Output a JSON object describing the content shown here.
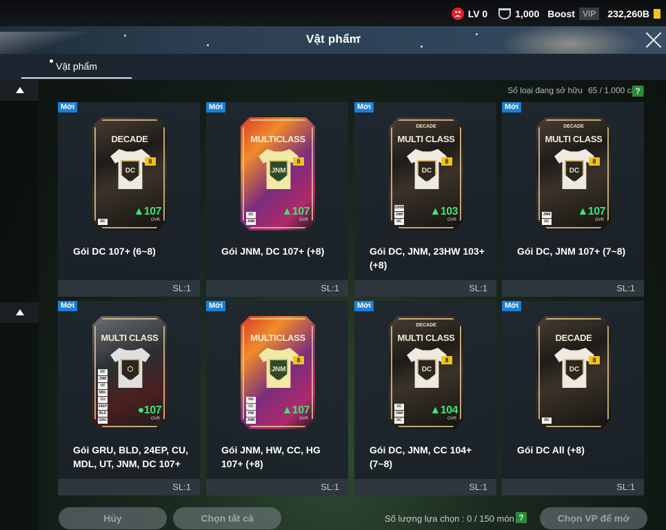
{
  "status": {
    "level": "LV 0",
    "trophies": "1,000",
    "boost": "Boost",
    "vip": "VIP",
    "currency": "232,260B"
  },
  "window": {
    "title": "Vật phẩm"
  },
  "tabs": [
    {
      "label": "Vật phẩm",
      "active": true
    }
  ],
  "inventory": {
    "owned_label": "Số loại đang sở hữu",
    "owned_value": "65 / 1.000 cái",
    "help": "?"
  },
  "items": [
    {
      "badge": "Mới",
      "name": "Gói DC 107+ (6~8)",
      "qty": "SL:1",
      "pack_sup": "",
      "pack_title": "DECADE",
      "ovr": "107",
      "chips": [
        "DC"
      ]
    },
    {
      "badge": "Mới",
      "name": "Gói JNM, DC 107+ (+8)",
      "qty": "SL:1",
      "pack_sup": "",
      "pack_title": "MULTICLASS",
      "ovr": "107",
      "chips": [
        "DC",
        "JNM"
      ]
    },
    {
      "badge": "Mới",
      "name": "Gói DC, JNM, 23HW 103+ (+8)",
      "qty": "SL:1",
      "pack_sup": "DECADE",
      "pack_title": "MULTI CLASS",
      "ovr": "103",
      "chips": [
        "23HW",
        "JNM",
        "DC"
      ]
    },
    {
      "badge": "Mới",
      "name": "Gói DC, JNM 107+ (7~8)",
      "qty": "SL:1",
      "pack_sup": "DECADE",
      "pack_title": "MULTI CLASS",
      "ovr": "107",
      "chips": [
        "JNM",
        "DC"
      ]
    },
    {
      "badge": "Mới",
      "name": "Gói GRU, BLD, 24EP, CU, MDL, UT, JNM, DC 107+",
      "qty": "SL:1",
      "pack_sup": "",
      "pack_title": "MULTI CLASS",
      "ovr": "107",
      "chips": [
        "DC",
        "JNM",
        "UT",
        "MDL",
        "CU",
        "24EP",
        "BLD",
        "GRU"
      ]
    },
    {
      "badge": "Mới",
      "name": "Gói JNM, HW, CC, HG 107+ (+8)",
      "qty": "SL:1",
      "pack_sup": "",
      "pack_title": "MULTICLASS",
      "ovr": "107",
      "chips": [
        "HG",
        "CC",
        "HW",
        "JNM"
      ]
    },
    {
      "badge": "Mới",
      "name": "Gói DC, JNM, CC 104+ (7~8)",
      "qty": "SL:1",
      "pack_sup": "DECADE",
      "pack_title": "MULTI CLASS",
      "ovr": "104",
      "chips": [
        "CC",
        "JNM",
        "DC"
      ]
    },
    {
      "badge": "Mới",
      "name": "Gói DC All (+8)",
      "qty": "SL:1",
      "pack_sup": "",
      "pack_title": "DECADE",
      "ovr": "",
      "chips": [
        "DC"
      ]
    }
  ],
  "bottom": {
    "cancel": "Hủy",
    "select_all": "Chọn tất cả",
    "selection_label": "Số lượng lựa chọn : 0 / 150 món",
    "help": "?",
    "open": "Chọn VP để mở"
  },
  "colors": {
    "new_badge": "#1b7fd6",
    "ovr_green": "#3ee57a",
    "help_green": "#2d8a3a",
    "alert_red": "#e5202a"
  }
}
